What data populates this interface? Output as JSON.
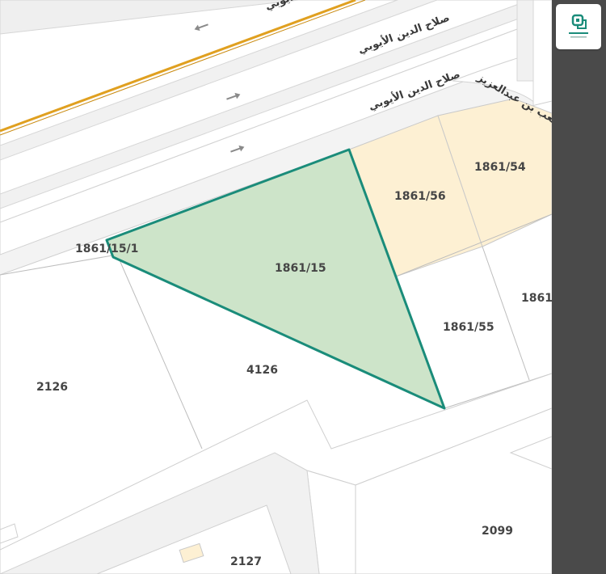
{
  "streets": {
    "street_top_partial": "صلاح الدين الأيوبي",
    "street_1": "صلاح الدين الأيوبي",
    "street_2": "صلاح الدين الأيوبي",
    "street_corner": "طريق متعب بن عبدالعزيز"
  },
  "parcels": {
    "selected": "1861/15",
    "p_15_1": "1861/15/1",
    "p_56": "1861/56",
    "p_54": "1861/54",
    "p_55": "1861/55",
    "p_right_partial": "1861/",
    "p_4126": "4126",
    "p_2126": "2126",
    "p_2099": "2099",
    "p_2127": "2127"
  },
  "colors": {
    "selected_fill": "#cde4c9",
    "selected_outline": "#1a8c7a",
    "highlight_fill": "#fdf0d3",
    "road_fill": "#ffffff",
    "road_centerline": "#e0a020",
    "sidebar_bg": "#4a4a4a"
  },
  "icons": {
    "direction_arrow": "arrow-icon",
    "logo": "brand-logo-icon"
  }
}
